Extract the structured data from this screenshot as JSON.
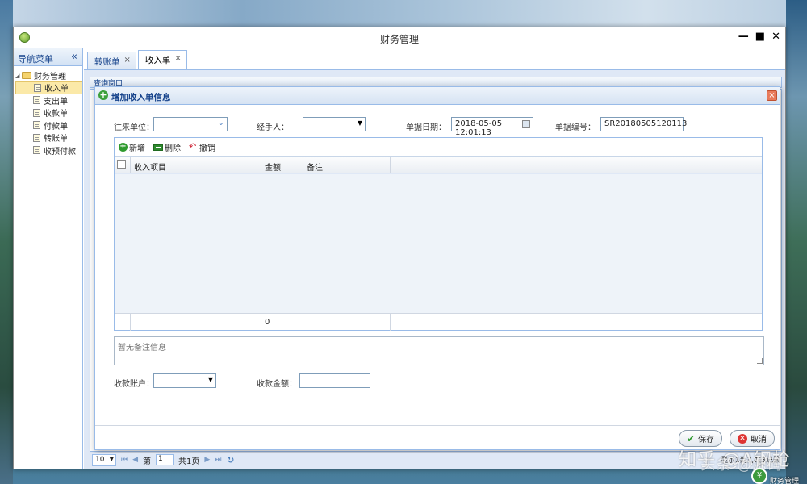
{
  "window": {
    "title": "财务管理",
    "controls": [
      "—",
      "■",
      "✕"
    ]
  },
  "sidebar": {
    "title": "导航菜单",
    "collapse": "«",
    "root": "财务管理",
    "items": [
      {
        "label": "收入单"
      },
      {
        "label": "支出单"
      },
      {
        "label": "收款单"
      },
      {
        "label": "付款单"
      },
      {
        "label": "转账单"
      },
      {
        "label": "收预付款"
      }
    ]
  },
  "tabs": [
    {
      "label": "转账单",
      "close": "×"
    },
    {
      "label": "收入单",
      "close": "×"
    }
  ],
  "query_panel": {
    "title": "查询窗口"
  },
  "dialog": {
    "title": "增加收入单信息",
    "close": "×",
    "fields": {
      "partner_label": "往来单位：",
      "partner_value": "",
      "handler_label": "经手人：",
      "handler_value": "",
      "date_label": "单据日期：",
      "date_value": "2018-05-05 12:01:13",
      "number_label": "单据编号：",
      "number_value": "SR20180505120113"
    },
    "toolbar": {
      "add": "新增",
      "delete": "删除",
      "undo": "撤销"
    },
    "columns": [
      "收入项目",
      "金额",
      "备注"
    ],
    "footer_total": "0",
    "remark_placeholder": "暂无备注信息",
    "account_label": "收款账户：",
    "account_value": "",
    "amount_label": "收款金额：",
    "amount_value": "",
    "save": "保存",
    "cancel": "取消"
  },
  "pager": {
    "page_size": "10",
    "page_label": "第",
    "page_value": "1",
    "total_pages": "共1页",
    "info": "显示1到3,共3记录"
  },
  "watermark": "知乎 @A钢枪",
  "watermark2": "头条 @源码",
  "desktop_icon_label": "财务管理"
}
